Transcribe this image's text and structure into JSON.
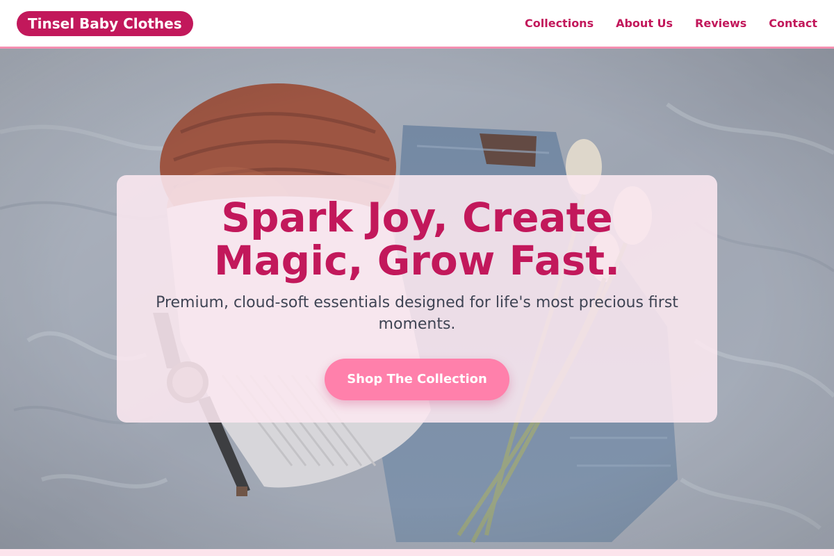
{
  "brand": {
    "name": "Tinsel Baby Clothes"
  },
  "nav": {
    "items": [
      {
        "label": "Collections"
      },
      {
        "label": "About Us"
      },
      {
        "label": "Reviews"
      },
      {
        "label": "Contact"
      }
    ]
  },
  "hero": {
    "title": "Spark Joy, Create Magic, Grow Fast.",
    "subtitle": "Premium, cloud-soft essentials designed for life's most precious first moments.",
    "cta_label": "Shop The Collection",
    "background_photo": "flat-lay of knit beanie, sweater, jeans, wristwatch and tulips on grey bedsheet"
  },
  "colors": {
    "brand_primary": "#c2185b",
    "cta_pink": "#ff80ab",
    "header_border": "#f48fb1",
    "card_background": "#fce8f0",
    "subtitle_text": "#3f4454"
  }
}
